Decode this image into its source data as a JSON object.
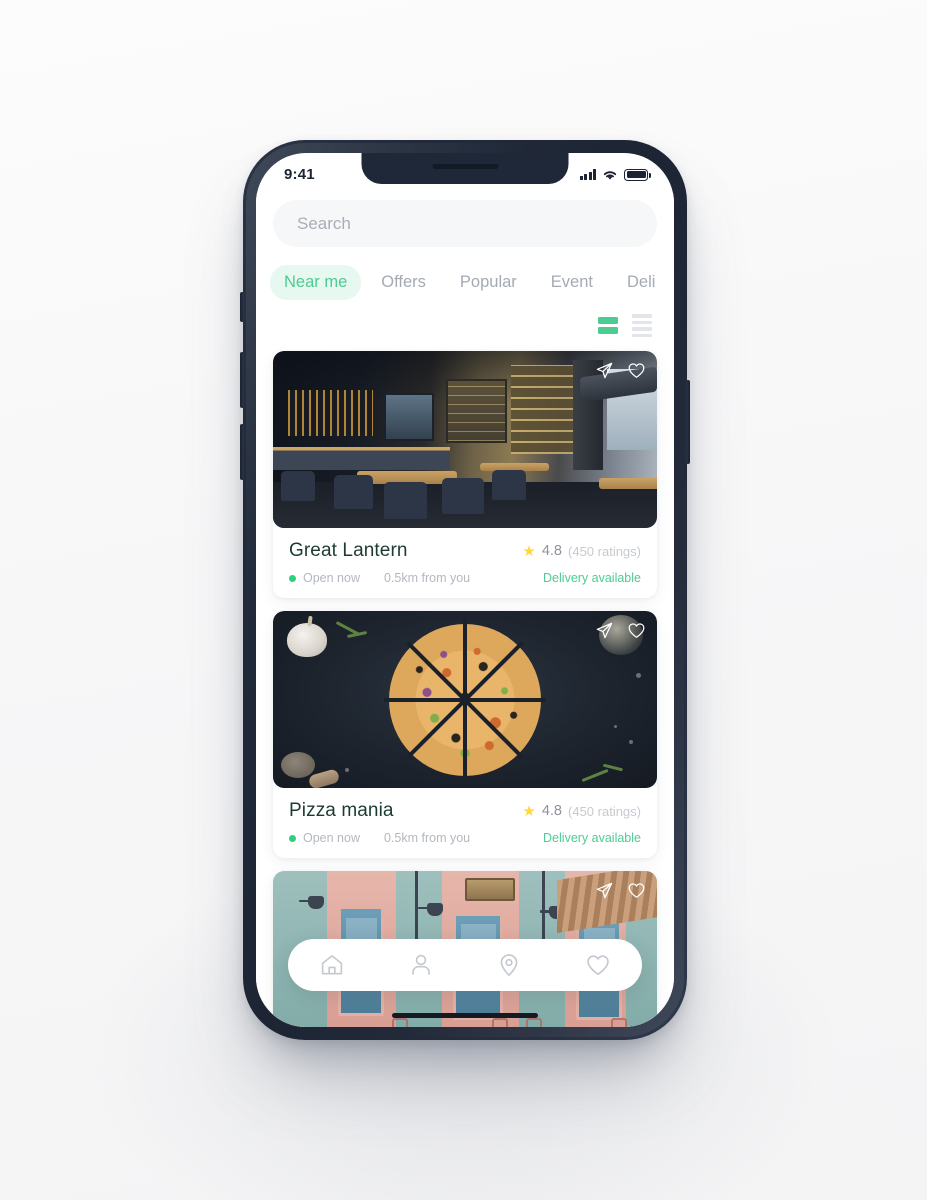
{
  "device": {
    "frame_color": "#1d2534",
    "notch": "notch-speaker"
  },
  "status_bar": {
    "time": "9:41",
    "icons": [
      "signal-icon",
      "wifi-icon",
      "battery-icon"
    ]
  },
  "search": {
    "placeholder": "Search",
    "value": ""
  },
  "tabs": [
    {
      "label": "Near me",
      "active": true
    },
    {
      "label": "Offers",
      "active": false
    },
    {
      "label": "Popular",
      "active": false
    },
    {
      "label": "Event",
      "active": false
    },
    {
      "label": "Deli",
      "active": false
    }
  ],
  "view_toggles": {
    "grid_active": true,
    "grid_color": "#4ecb93",
    "list_color": "#e2e5e9"
  },
  "colors": {
    "accent_green": "#4ecb93",
    "pill_bg": "#e6f8ef",
    "open_dot": "#2fcf7f",
    "star": "#ffd83d",
    "title": "#1d3b34",
    "muted": "#b3b8c0"
  },
  "cards": [
    {
      "name": "Great Lantern",
      "rating": "4.8",
      "rating_count": "(450 ratings)",
      "status": "Open now",
      "distance": "0.5km from you",
      "delivery": "Delivery available",
      "photo": "restaurant-interior-photo",
      "actions": [
        "share-icon",
        "heart-icon"
      ]
    },
    {
      "name": "Pizza mania",
      "rating": "4.8",
      "rating_count": "(450 ratings)",
      "status": "Open now",
      "distance": "0.5km from you",
      "delivery": "Delivery available",
      "photo": "pizza-photo",
      "actions": [
        "share-icon",
        "heart-icon"
      ]
    },
    {
      "name": "",
      "rating": "",
      "rating_count": "",
      "status": "",
      "distance": "",
      "delivery": "",
      "photo": "pastel-facade-photo",
      "actions": [
        "share-icon",
        "heart-icon"
      ]
    }
  ],
  "bottom_nav": [
    {
      "icon": "home-icon",
      "active": false
    },
    {
      "icon": "profile-icon",
      "active": false
    },
    {
      "icon": "location-pin-icon",
      "active": false
    },
    {
      "icon": "heart-icon",
      "active": false
    }
  ]
}
